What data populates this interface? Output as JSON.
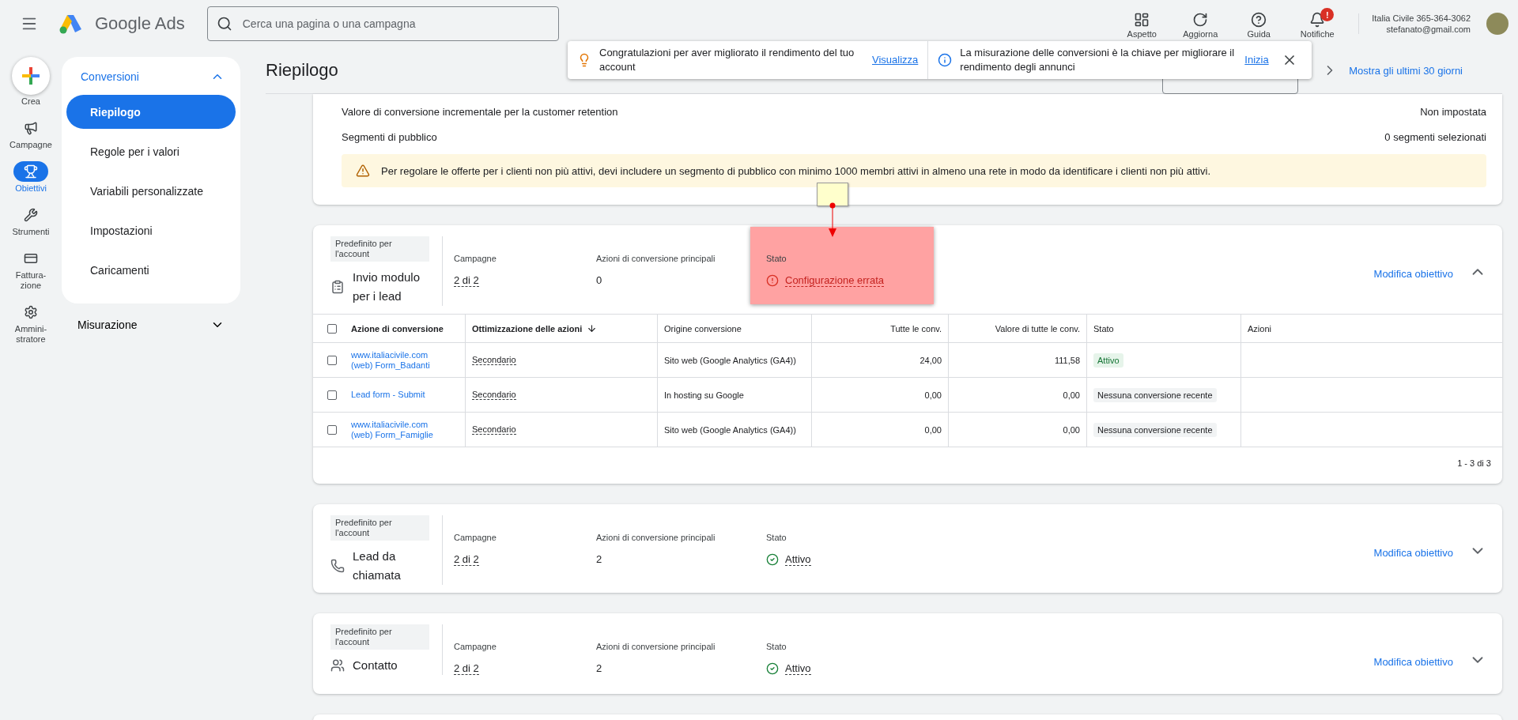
{
  "header": {
    "product": "Google Ads",
    "search": {
      "placeholder": "Cerca una pagina o una campagna"
    },
    "actions": [
      {
        "label": "Aspetto",
        "kind": "appearance"
      },
      {
        "label": "Aggiorna",
        "kind": "refresh"
      },
      {
        "label": "Guida",
        "kind": "help"
      },
      {
        "label": "Notifiche",
        "kind": "notifications",
        "badge": "!"
      }
    ],
    "account": {
      "name": "Italia Civile 365-364-3062",
      "email": "stefanato@gmail.com"
    }
  },
  "rail": [
    {
      "label": "Crea",
      "kind": "create",
      "selected": false
    },
    {
      "label": "Campagne",
      "kind": "campaigns",
      "selected": false
    },
    {
      "label": "Obiettivi",
      "kind": "goals",
      "selected": true
    },
    {
      "label": "Strumenti",
      "kind": "tools",
      "selected": false
    },
    {
      "label": "Fattura-\nzione",
      "kind": "billing",
      "selected": false
    },
    {
      "label": "Ammini-\nstratore",
      "kind": "admin",
      "selected": false
    }
  ],
  "nav": {
    "section": "Conversioni",
    "expanded": true,
    "items": [
      {
        "label": "Riepilogo",
        "selected": true
      },
      {
        "label": "Regole per i valori",
        "selected": false
      },
      {
        "label": "Variabili personalizzate",
        "selected": false
      },
      {
        "label": "Impostazioni",
        "selected": false
      },
      {
        "label": "Caricamenti",
        "selected": false
      }
    ],
    "other_sections": [
      {
        "label": "Misurazione",
        "expanded": false
      }
    ]
  },
  "page_title": "Riepilogo",
  "date_link": "Mostra gli ultimi 30 giorni",
  "notifications": [
    {
      "kind": "tip",
      "text": "Congratulazioni per aver migliorato il rendimento del tuo account",
      "action": "Visualizza"
    },
    {
      "kind": "info",
      "text": "La misurazione delle conversioni è la chiave per migliorare il rendimento degli annunci",
      "action": "Inizia"
    }
  ],
  "settings_card": {
    "rows": [
      {
        "label": "Valore di conversione incrementale per la customer retention",
        "value": "Non impostata"
      },
      {
        "label": "Segmenti di pubblico",
        "value": "0 segmenti selezionati"
      }
    ],
    "warning": "Per regolare le offerte per i clienti non più attivi, devi includere un segmento di pubblico con minimo 1000 membri attivi in almeno una rete in modo da identificare i clienti non più attivi."
  },
  "goals": [
    {
      "kind": "error",
      "tag": "Predefinito per l'account",
      "name": "Invio modulo per i lead",
      "campaigns_label": "Campagne",
      "campaigns": "2 di 2",
      "actions_label": "Azioni di conversione principali",
      "actions": "0",
      "status_label": "Stato",
      "status": "Configurazione errata",
      "highlighted": true,
      "edit": "Modifica obiettivo",
      "expanded": true,
      "table": {
        "all_checked": false,
        "columns": [
          {
            "label": "Azione di conversione",
            "sorted": false
          },
          {
            "label": "Ottimizzazione delle azioni",
            "sorted": true
          },
          {
            "label": "Origine conversione",
            "sorted": false
          },
          {
            "label": "Tutte le conv.",
            "sorted": false
          },
          {
            "label": "Valore di tutte le conv.",
            "sorted": false
          },
          {
            "label": "Stato",
            "sorted": false
          },
          {
            "label": "Azioni",
            "sorted": false
          }
        ],
        "rows": [
          {
            "kind": "active",
            "checked": false,
            "action": "www.italiacivile.com\n(web) Form_Badanti",
            "optimization": "Secondario",
            "source": "Sito web (Google Analytics (GA4))",
            "all_conv": "24,00",
            "value": "111,58",
            "status": "Attivo"
          },
          {
            "kind": "inactive",
            "checked": false,
            "action": "Lead form - Submit",
            "optimization": "Secondario",
            "source": "In hosting su Google",
            "all_conv": "0,00",
            "value": "0,00",
            "status": "Nessuna conversione recente"
          },
          {
            "kind": "inactive",
            "checked": false,
            "action": "www.italiacivile.com\n(web) Form_Famiglie",
            "optimization": "Secondario",
            "source": "Sito web (Google Analytics (GA4))",
            "all_conv": "0,00",
            "value": "0,00",
            "status": "Nessuna conversione recente"
          }
        ],
        "pagination": "1 - 3 di 3"
      }
    },
    {
      "kind": "active",
      "tag": "Predefinito per l'account",
      "name": "Lead da chiamata",
      "campaigns_label": "Campagne",
      "campaigns": "2 di 2",
      "actions_label": "Azioni di conversione principali",
      "actions": "2",
      "status_label": "Stato",
      "status": "Attivo",
      "highlighted": false,
      "edit": "Modifica obiettivo",
      "expanded": false
    },
    {
      "kind": "active",
      "tag": "Predefinito per l'account",
      "name": "Contatto",
      "campaigns_label": "Campagne",
      "campaigns": "2 di 2",
      "actions_label": "Azioni di conversione principali",
      "actions": "2",
      "status_label": "Stato",
      "status": "Attivo",
      "highlighted": false,
      "edit": "Modifica obiettivo",
      "expanded": false
    }
  ]
}
